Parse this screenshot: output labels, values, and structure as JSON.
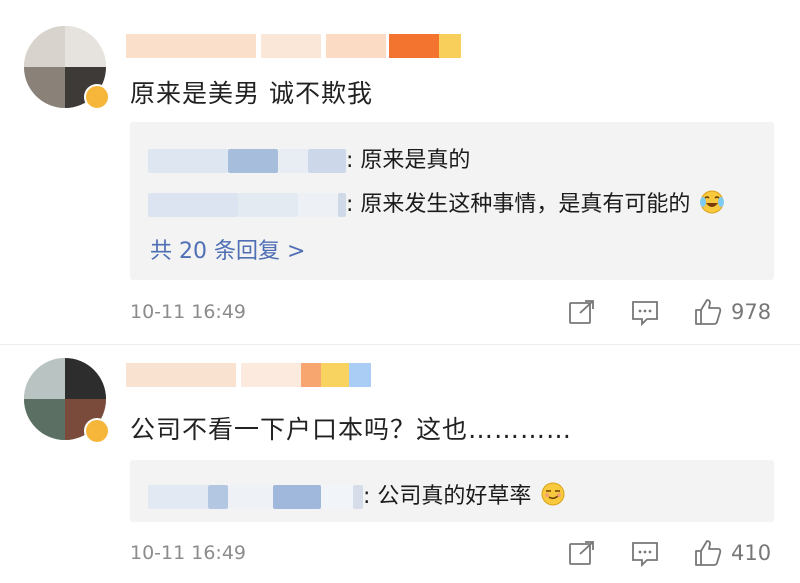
{
  "comments": [
    {
      "text": "原来是美男 诚不欺我",
      "replies": [
        {
          "text": ": 原来是真的"
        },
        {
          "text": ": 原来发生这种事情，是真有可能的"
        }
      ],
      "more_replies": "共 20 条回复 >",
      "time": "10-11 16:49",
      "likes": "978",
      "reaction_emoji": "laughing-crying"
    },
    {
      "text": "公司不看一下户口本吗？这也…………",
      "replies": [
        {
          "text": ": 公司真的好草率"
        }
      ],
      "time": "10-11 16:49",
      "likes": "410",
      "reaction_emoji": "smirk"
    }
  ],
  "colors": {
    "more_link": "#4f6fb4",
    "timestamp": "#8c8c8c",
    "reply_bg": "#f3f3f3",
    "badge": "#f6b63a"
  }
}
